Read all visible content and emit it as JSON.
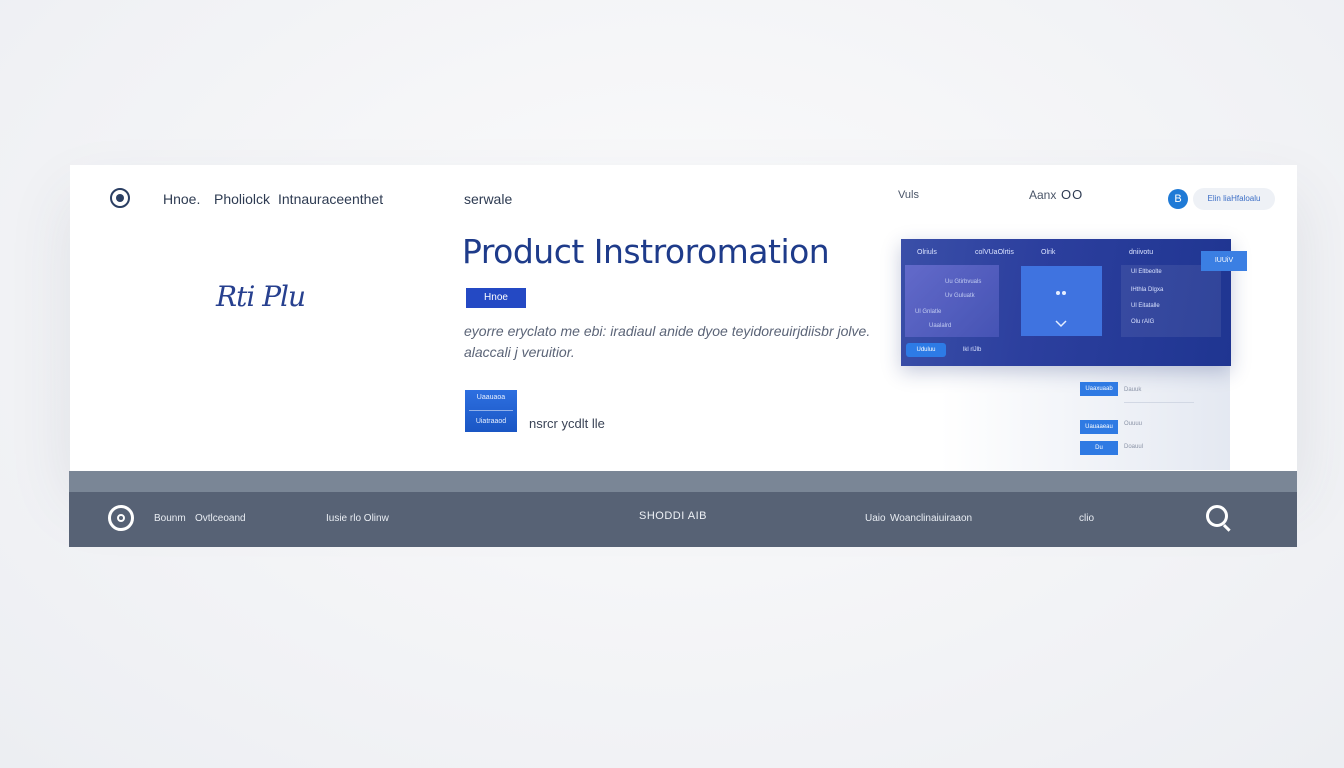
{
  "nav": {
    "links": [
      "Hnoe.",
      "Pholiolck",
      "Intnauraceenthet",
      "serwale"
    ],
    "right_link": "Vuls",
    "user_label": "Aanx",
    "user_icon_text": "OO",
    "badge_text": "B",
    "pill_text": "Elin liaHfaloalu"
  },
  "brand": {
    "signature": "Rti Plu"
  },
  "hero": {
    "title": "Product Instroromation",
    "tag": "Hnoe",
    "description": "eyorre eryclato me ebi: iradiaul anide dyoe teyidoreuirjdiisbr jolve. alaccali j veruitior.",
    "cta_line1": "Uaauaoa",
    "cta_line2": "Uiatraaod",
    "cta_link": "nsrcr ycdlt lle"
  },
  "mockup": {
    "tabs": [
      "Olriuls",
      "colVUaOlrtis",
      "Olrik",
      "dniivotu"
    ],
    "left_rows": [
      "Uu Gtirbvuals",
      "Uv Guluatk",
      "Ul Gnlatle",
      "Uaalalrd"
    ],
    "right_rows": [
      "Ul Eltbeolte",
      "lHthla Dlgxa",
      "Ul Eitatalle",
      "Olu rAIG"
    ],
    "pill": "Uduluu",
    "pill_side": "lkl rlJlb",
    "corner": "IUUiV",
    "mini_buttons": [
      "Uaaxuaab",
      "Uauaaeau",
      "Du"
    ],
    "mini_texts": [
      "Dauuk",
      "Ouuuu",
      "Doauul"
    ]
  },
  "footer": {
    "left_a": "Bounm",
    "left_b": "Ovtlceoand",
    "mid_left": "Iusie rlo Olinw",
    "center": "SHODDI AIB",
    "right_a": "Uaio",
    "right_b": "Woanclinaiuiraaon",
    "right_c": "clio"
  },
  "colors": {
    "accent": "#2449c4",
    "title": "#1e3b8a",
    "footer": "#576275",
    "footer_top": "#7a8696"
  }
}
